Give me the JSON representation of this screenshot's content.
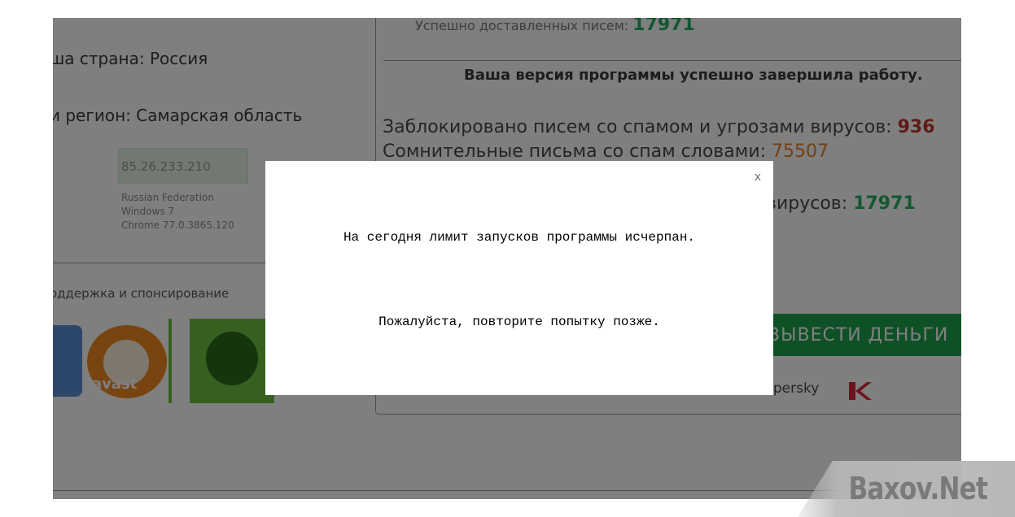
{
  "background_page": {
    "left": {
      "country_line": "ша страна:  Россия",
      "region_line": "и регион: Самарская область",
      "ip": "85.26.233.210",
      "system_info": [
        "Russian Federation",
        "Windows 7",
        "Chrome 77.0.3865.120"
      ],
      "support_label": "оддержка и спонсирование"
    },
    "right": {
      "delivered_label": "Успешно доставленных писем:",
      "delivered_value": "17971",
      "program_status": "Ваша версия программы успешно завершила работу.",
      "blocked_label": "Заблокировано писем со спамом и угрозами вирусов:",
      "blocked_value": "936",
      "suspicious_label": "Сомнительные письма со спам словами:",
      "suspicious_value": "75507",
      "viruses_label": "вирусов:",
      "viruses_value": "17971",
      "withdraw_button": "ВЫВЕСТИ ДЕНЬГИ",
      "kaspersky_label": "spersky"
    }
  },
  "modal": {
    "close_label": "x",
    "message_line1": "На сегодня лимит запусков программы исчерпан.",
    "message_line2": "Пожалуйста, повторите попытку позже."
  },
  "watermark": "Baxov.Net",
  "colors": {
    "overlay": "rgba(0,0,0,0.5)",
    "button_green": "#1fa34c",
    "value_green": "#27ae60",
    "value_red": "#c0392b",
    "value_orange": "#e67e22"
  }
}
